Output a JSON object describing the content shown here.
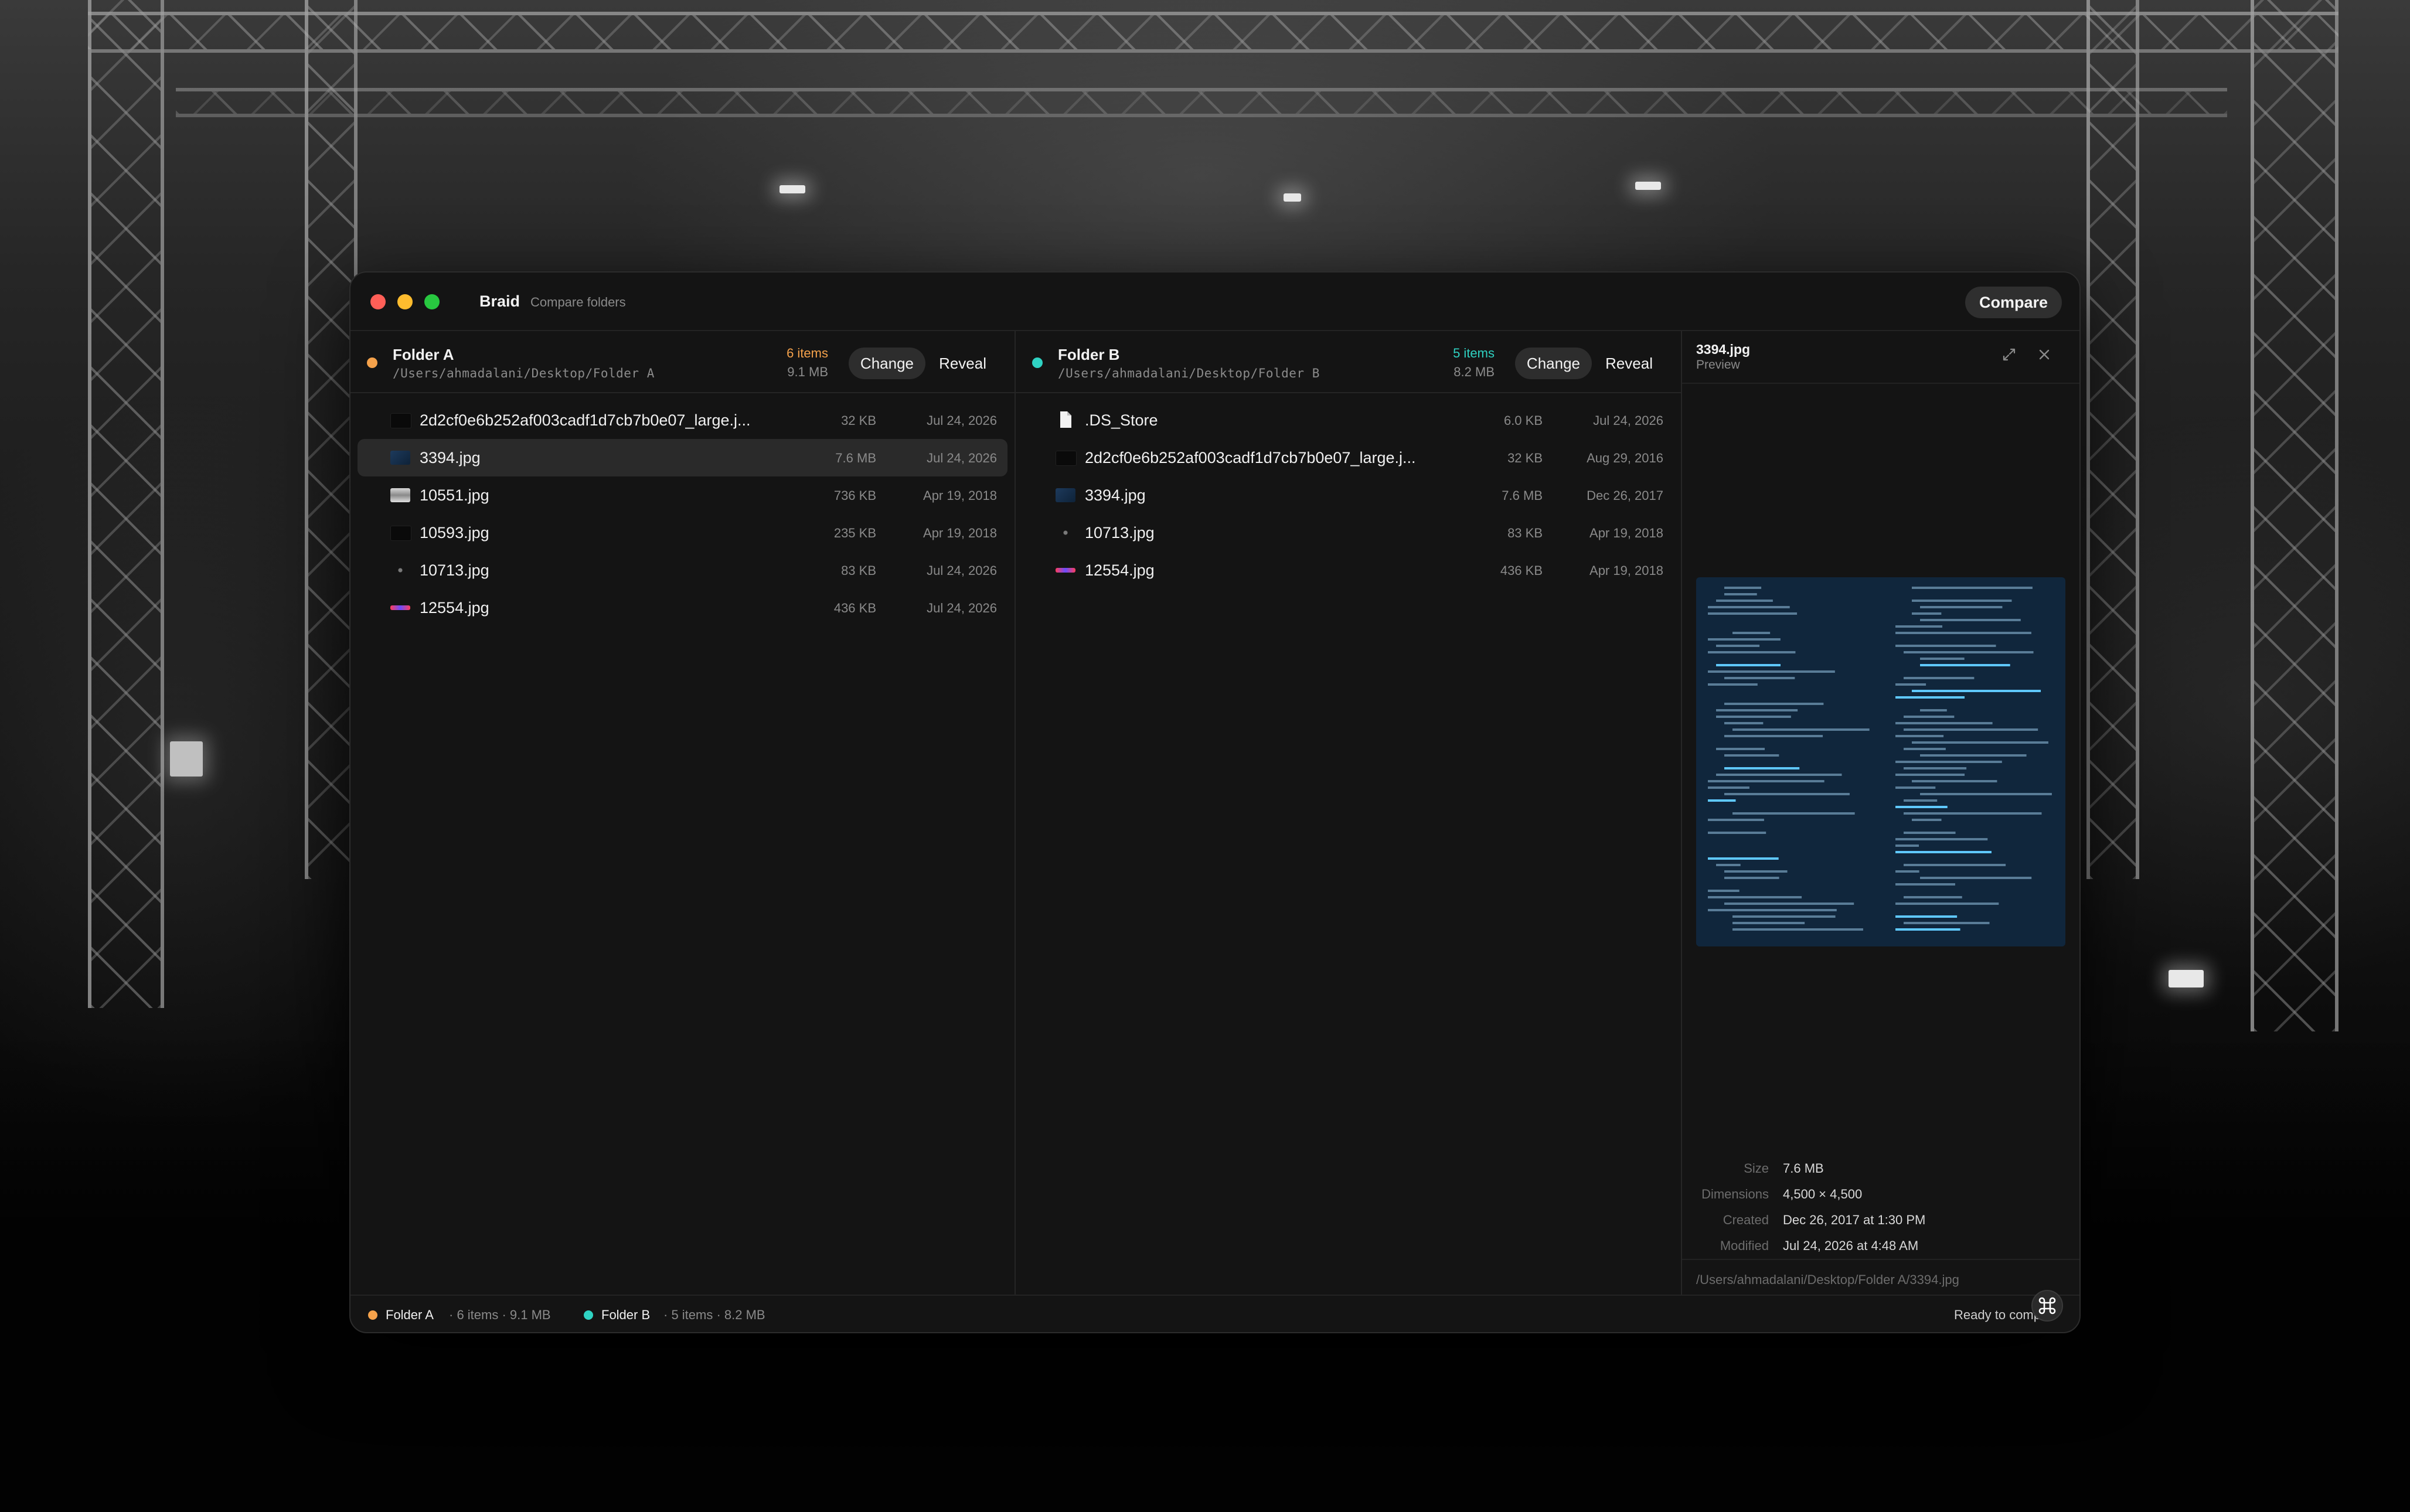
{
  "window": {
    "app_name": "Braid",
    "subtitle": "Compare folders",
    "compare_label": "Compare"
  },
  "colors": {
    "folder_a": "#f5a24b",
    "folder_b": "#2fd3c3",
    "close": "#ff5f57",
    "minimize": "#febc2e",
    "zoom": "#28c840"
  },
  "folder_a": {
    "name": "Folder A",
    "path": "/Users/ahmadalani/Desktop/Folder A",
    "count": "6 items",
    "size": "9.1 MB",
    "change_label": "Change",
    "reveal_label": "Reveal",
    "files": [
      {
        "name": "2d2cf0e6b252af003cadf1d7cb7b0e07_large.j...",
        "size": "32 KB",
        "date": "Jul 24, 2026",
        "thumb": "dark"
      },
      {
        "name": "3394.jpg",
        "size": "7.6 MB",
        "date": "Jul 24, 2026",
        "thumb": "blue",
        "selected": true
      },
      {
        "name": "10551.jpg",
        "size": "736 KB",
        "date": "Apr 19, 2018",
        "thumb": "light"
      },
      {
        "name": "10593.jpg",
        "size": "235 KB",
        "date": "Apr 19, 2018",
        "thumb": "dark"
      },
      {
        "name": "10713.jpg",
        "size": "83 KB",
        "date": "Jul 24, 2026",
        "thumb": "dot"
      },
      {
        "name": "12554.jpg",
        "size": "436 KB",
        "date": "Jul 24, 2026",
        "thumb": "color"
      }
    ]
  },
  "folder_b": {
    "name": "Folder B",
    "path": "/Users/ahmadalani/Desktop/Folder B",
    "count": "5 items",
    "size": "8.2 MB",
    "change_label": "Change",
    "reveal_label": "Reveal",
    "files": [
      {
        "name": ".DS_Store",
        "size": "6.0 KB",
        "date": "Jul 24, 2026",
        "thumb": "doc"
      },
      {
        "name": "2d2cf0e6b252af003cadf1d7cb7b0e07_large.j...",
        "size": "32 KB",
        "date": "Aug 29, 2016",
        "thumb": "dark"
      },
      {
        "name": "3394.jpg",
        "size": "7.6 MB",
        "date": "Dec 26, 2017",
        "thumb": "blue"
      },
      {
        "name": "10713.jpg",
        "size": "83 KB",
        "date": "Apr 19, 2018",
        "thumb": "dot"
      },
      {
        "name": "12554.jpg",
        "size": "436 KB",
        "date": "Apr 19, 2018",
        "thumb": "color"
      }
    ]
  },
  "preview": {
    "title": "3394.jpg",
    "subtitle": "Preview",
    "expand_icon": "expand-icon",
    "close_icon": "close-icon",
    "meta": [
      {
        "key": "Size",
        "value": "7.6 MB"
      },
      {
        "key": "Dimensions",
        "value": "4,500 × 4,500"
      },
      {
        "key": "Created",
        "value": "Dec 26, 2017 at 1:30 PM"
      },
      {
        "key": "Modified",
        "value": "Jul 24, 2026 at 4:48 AM"
      }
    ],
    "path": "/Users/ahmadalani/Desktop/Folder A/3394.jpg"
  },
  "status": {
    "a_name": "Folder A",
    "a_meta": "· 6 items · 9.1 MB",
    "b_name": "Folder B",
    "b_meta": "· 5 items · 8.2 MB",
    "ready": "Ready to comp",
    "command_icon": "command-icon"
  }
}
